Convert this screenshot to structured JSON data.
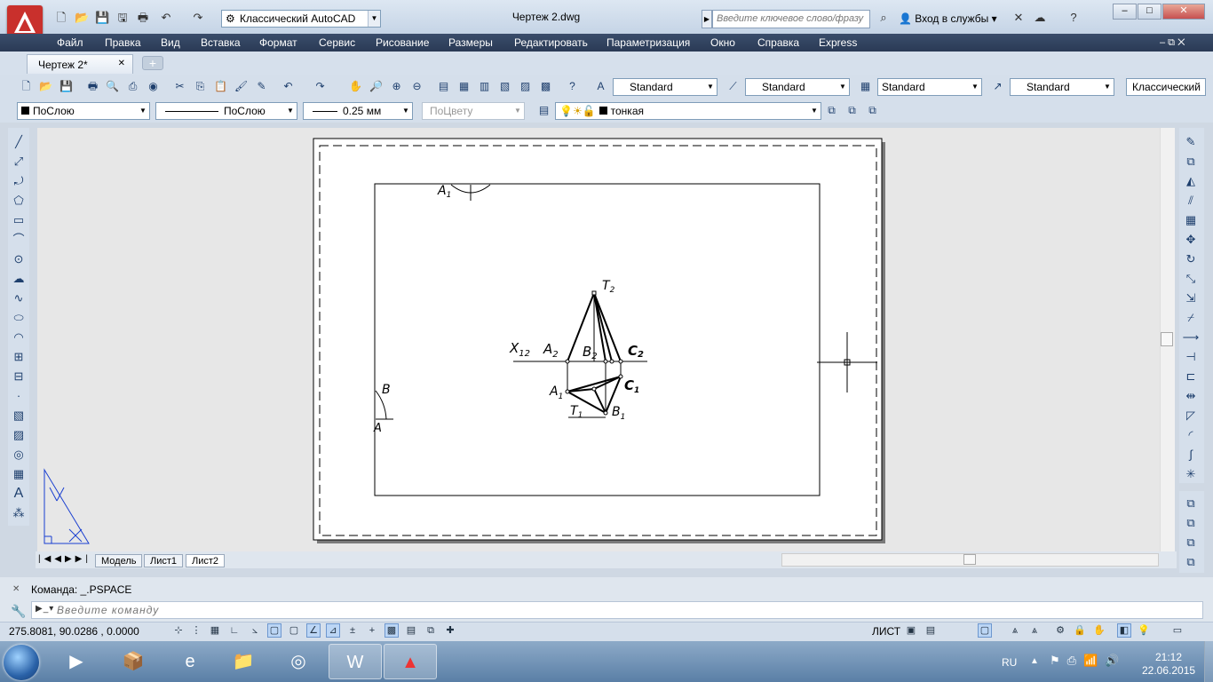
{
  "window": {
    "title": "Чертеж 2.dwg",
    "workspace": "Классический AutoCAD"
  },
  "search": {
    "placeholder": "Введите ключевое слово/фразу"
  },
  "login": {
    "label": "Вход в службы"
  },
  "menu": [
    "Файл",
    "Правка",
    "Вид",
    "Вставка",
    "Формат",
    "Сервис",
    "Рисование",
    "Размеры",
    "Редактировать",
    "Параметризация",
    "Окно",
    "Справка",
    "Express"
  ],
  "doc_tab": {
    "label": "Чертеж 2*"
  },
  "styles": {
    "text": "Standard",
    "dim": "Standard",
    "table": "Standard",
    "mleader": "Standard",
    "workspace": "Классический"
  },
  "props": {
    "layer_color": "ПоСлою",
    "linetype": "ПоСлою",
    "lineweight": "0.25 мм",
    "plotstyle": "ПоЦвету",
    "layer": "тонкая"
  },
  "layout_tabs": [
    "Модель",
    "Лист1",
    "Лист2"
  ],
  "active_layout": "Лист2",
  "command": {
    "history": "Команда:  _.PSPACE",
    "placeholder": "Введите команду"
  },
  "status": {
    "coords": "275.8081,  90.0286  , 0.0000",
    "space": "ЛИСТ"
  },
  "taskbar": {
    "lang": "RU",
    "time": "21:12",
    "date": "22.06.2015"
  },
  "drawing_labels": {
    "t2": "T",
    "t2_sub": "2",
    "x12": "X",
    "x12_sub": "12",
    "a2": "A",
    "a2_sub": "2",
    "b2": "B",
    "b2_sub": "2",
    "c2": "C",
    "c2_sub": "2",
    "a1": "A",
    "a1_sub": "1",
    "c1": "C",
    "c1_sub": "1",
    "t1": "T",
    "t1_sub": "1",
    "b1": "B",
    "b1_sub": "1",
    "a1_top": "A",
    "a1_top_sub": "1",
    "b_left": "B",
    "a_left": "A"
  },
  "colors": {
    "menubar": "#2a3a55",
    "titlebar": "#c5d4e6",
    "app_red": "#c9302c",
    "ucs_blue": "#1a3fd0"
  }
}
